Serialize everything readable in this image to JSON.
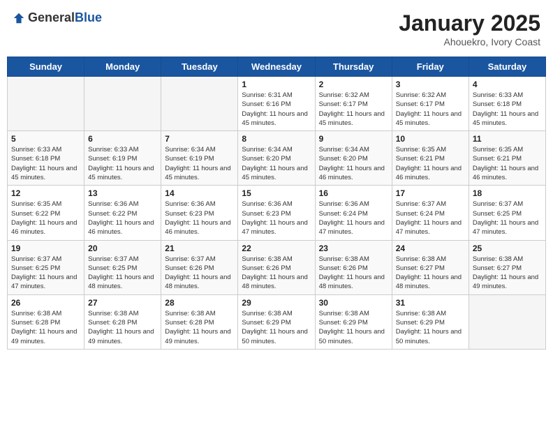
{
  "header": {
    "logo_general": "General",
    "logo_blue": "Blue",
    "month": "January 2025",
    "location": "Ahouekro, Ivory Coast"
  },
  "days_of_week": [
    "Sunday",
    "Monday",
    "Tuesday",
    "Wednesday",
    "Thursday",
    "Friday",
    "Saturday"
  ],
  "weeks": [
    [
      {
        "day": "",
        "info": ""
      },
      {
        "day": "",
        "info": ""
      },
      {
        "day": "",
        "info": ""
      },
      {
        "day": "1",
        "info": "Sunrise: 6:31 AM\nSunset: 6:16 PM\nDaylight: 11 hours and 45 minutes."
      },
      {
        "day": "2",
        "info": "Sunrise: 6:32 AM\nSunset: 6:17 PM\nDaylight: 11 hours and 45 minutes."
      },
      {
        "day": "3",
        "info": "Sunrise: 6:32 AM\nSunset: 6:17 PM\nDaylight: 11 hours and 45 minutes."
      },
      {
        "day": "4",
        "info": "Sunrise: 6:33 AM\nSunset: 6:18 PM\nDaylight: 11 hours and 45 minutes."
      }
    ],
    [
      {
        "day": "5",
        "info": "Sunrise: 6:33 AM\nSunset: 6:18 PM\nDaylight: 11 hours and 45 minutes."
      },
      {
        "day": "6",
        "info": "Sunrise: 6:33 AM\nSunset: 6:19 PM\nDaylight: 11 hours and 45 minutes."
      },
      {
        "day": "7",
        "info": "Sunrise: 6:34 AM\nSunset: 6:19 PM\nDaylight: 11 hours and 45 minutes."
      },
      {
        "day": "8",
        "info": "Sunrise: 6:34 AM\nSunset: 6:20 PM\nDaylight: 11 hours and 45 minutes."
      },
      {
        "day": "9",
        "info": "Sunrise: 6:34 AM\nSunset: 6:20 PM\nDaylight: 11 hours and 46 minutes."
      },
      {
        "day": "10",
        "info": "Sunrise: 6:35 AM\nSunset: 6:21 PM\nDaylight: 11 hours and 46 minutes."
      },
      {
        "day": "11",
        "info": "Sunrise: 6:35 AM\nSunset: 6:21 PM\nDaylight: 11 hours and 46 minutes."
      }
    ],
    [
      {
        "day": "12",
        "info": "Sunrise: 6:35 AM\nSunset: 6:22 PM\nDaylight: 11 hours and 46 minutes."
      },
      {
        "day": "13",
        "info": "Sunrise: 6:36 AM\nSunset: 6:22 PM\nDaylight: 11 hours and 46 minutes."
      },
      {
        "day": "14",
        "info": "Sunrise: 6:36 AM\nSunset: 6:23 PM\nDaylight: 11 hours and 46 minutes."
      },
      {
        "day": "15",
        "info": "Sunrise: 6:36 AM\nSunset: 6:23 PM\nDaylight: 11 hours and 47 minutes."
      },
      {
        "day": "16",
        "info": "Sunrise: 6:36 AM\nSunset: 6:24 PM\nDaylight: 11 hours and 47 minutes."
      },
      {
        "day": "17",
        "info": "Sunrise: 6:37 AM\nSunset: 6:24 PM\nDaylight: 11 hours and 47 minutes."
      },
      {
        "day": "18",
        "info": "Sunrise: 6:37 AM\nSunset: 6:25 PM\nDaylight: 11 hours and 47 minutes."
      }
    ],
    [
      {
        "day": "19",
        "info": "Sunrise: 6:37 AM\nSunset: 6:25 PM\nDaylight: 11 hours and 47 minutes."
      },
      {
        "day": "20",
        "info": "Sunrise: 6:37 AM\nSunset: 6:25 PM\nDaylight: 11 hours and 48 minutes."
      },
      {
        "day": "21",
        "info": "Sunrise: 6:37 AM\nSunset: 6:26 PM\nDaylight: 11 hours and 48 minutes."
      },
      {
        "day": "22",
        "info": "Sunrise: 6:38 AM\nSunset: 6:26 PM\nDaylight: 11 hours and 48 minutes."
      },
      {
        "day": "23",
        "info": "Sunrise: 6:38 AM\nSunset: 6:26 PM\nDaylight: 11 hours and 48 minutes."
      },
      {
        "day": "24",
        "info": "Sunrise: 6:38 AM\nSunset: 6:27 PM\nDaylight: 11 hours and 48 minutes."
      },
      {
        "day": "25",
        "info": "Sunrise: 6:38 AM\nSunset: 6:27 PM\nDaylight: 11 hours and 49 minutes."
      }
    ],
    [
      {
        "day": "26",
        "info": "Sunrise: 6:38 AM\nSunset: 6:28 PM\nDaylight: 11 hours and 49 minutes."
      },
      {
        "day": "27",
        "info": "Sunrise: 6:38 AM\nSunset: 6:28 PM\nDaylight: 11 hours and 49 minutes."
      },
      {
        "day": "28",
        "info": "Sunrise: 6:38 AM\nSunset: 6:28 PM\nDaylight: 11 hours and 49 minutes."
      },
      {
        "day": "29",
        "info": "Sunrise: 6:38 AM\nSunset: 6:29 PM\nDaylight: 11 hours and 50 minutes."
      },
      {
        "day": "30",
        "info": "Sunrise: 6:38 AM\nSunset: 6:29 PM\nDaylight: 11 hours and 50 minutes."
      },
      {
        "day": "31",
        "info": "Sunrise: 6:38 AM\nSunset: 6:29 PM\nDaylight: 11 hours and 50 minutes."
      },
      {
        "day": "",
        "info": ""
      }
    ]
  ]
}
